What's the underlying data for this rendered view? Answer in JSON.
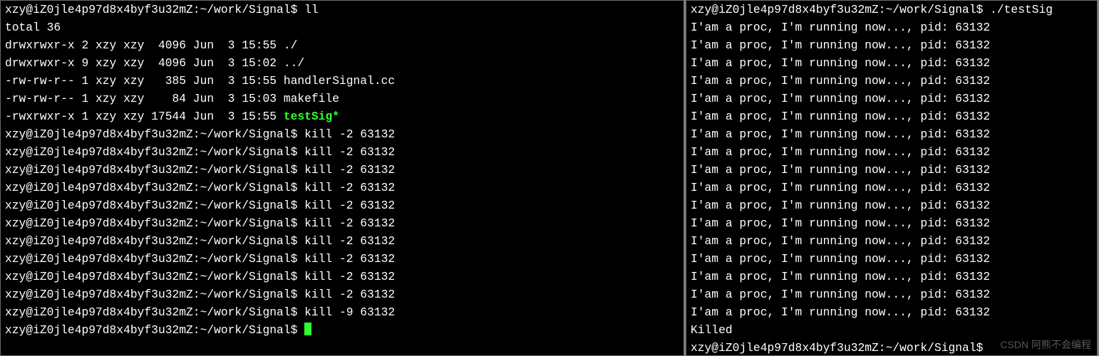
{
  "left": {
    "prompt": "xzy@iZ0jle4p97d8x4byf3u32mZ:~/work/Signal$ ",
    "cmd_ll": "ll",
    "total": "total 36",
    "ls": [
      {
        "perm": "drwxrwxr-x",
        "n": "2",
        "u": "xzy",
        "g": "xzy",
        "size": "4096",
        "date": "Jun  3 15:55",
        "name": "./",
        "exe": false
      },
      {
        "perm": "drwxrwxr-x",
        "n": "9",
        "u": "xzy",
        "g": "xzy",
        "size": "4096",
        "date": "Jun  3 15:02",
        "name": "../",
        "exe": false
      },
      {
        "perm": "-rw-rw-r--",
        "n": "1",
        "u": "xzy",
        "g": "xzy",
        "size": "385",
        "date": "Jun  3 15:55",
        "name": "handlerSignal.cc",
        "exe": false
      },
      {
        "perm": "-rw-rw-r--",
        "n": "1",
        "u": "xzy",
        "g": "xzy",
        "size": "84",
        "date": "Jun  3 15:03",
        "name": "makefile",
        "exe": false
      },
      {
        "perm": "-rwxrwxr-x",
        "n": "1",
        "u": "xzy",
        "g": "xzy",
        "size": "17544",
        "date": "Jun  3 15:55",
        "name": "testSig*",
        "exe": true
      }
    ],
    "kill2_count": 10,
    "kill2_cmd": "kill -2 63132",
    "kill9_cmd": "kill -9 63132"
  },
  "right": {
    "prompt": "xzy@iZ0jle4p97d8x4byf3u32mZ:~/work/Signal$ ",
    "run_cmd": "./testSig",
    "out_line": "I'am a proc, I'm running now..., pid: 63132",
    "out_count": 17,
    "killed": "Killed"
  },
  "watermark": "CSDN 阿熊不会编程"
}
